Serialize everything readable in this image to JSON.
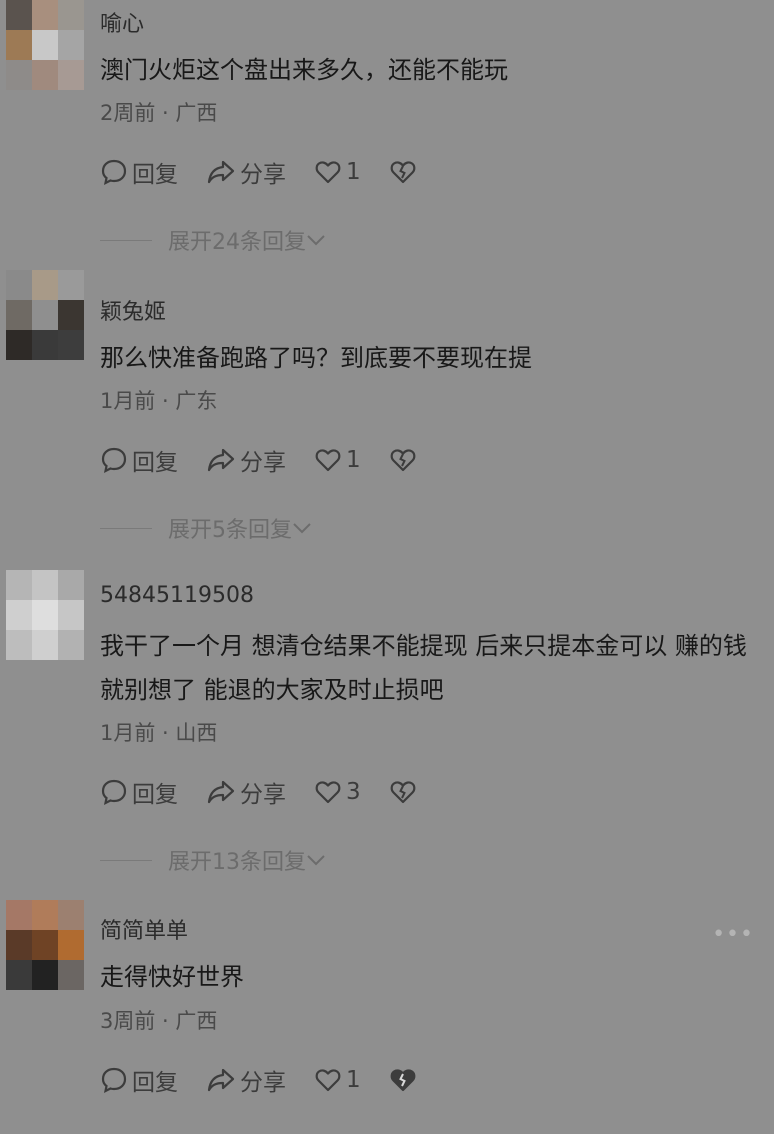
{
  "comments": [
    {
      "username": "喻心",
      "text": "澳门火炬这个盘出来多久，还能不能玩",
      "meta": "2周前 · 广西",
      "reply_label": "回复",
      "share_label": "分享",
      "likes": "1",
      "expand_label": "展开24条回复",
      "avatar_colors": [
        "#5a534e",
        "#a88f7e",
        "#9a9690",
        "#9d7a55",
        "#c8c8c8",
        "#a5a5a5",
        "#8e8b89",
        "#a08a7e",
        "#a79a94"
      ]
    },
    {
      "username": "颖兔姬",
      "text": "那么快准备跑路了吗？到底要不要现在提",
      "meta": "1月前 · 广东",
      "reply_label": "回复",
      "share_label": "分享",
      "likes": "1",
      "expand_label": "展开5条回复",
      "avatar_colors": [
        "#8a8a8a",
        "#a89a88",
        "#9a9a9a",
        "#6f6a64",
        "#8f8f8f",
        "#3b3631",
        "#2e2a27",
        "#3a3a3a",
        "#3d3d3d"
      ]
    },
    {
      "username": "54845119508",
      "text": "我干了一个月 想清仓结果不能提现 后来只提本金可以 赚的钱 就别想了 能退的大家及时止损吧",
      "meta": "1月前 · 山西",
      "reply_label": "回复",
      "share_label": "分享",
      "likes": "3",
      "expand_label": "展开13条回复",
      "avatar_colors": [
        "#b5b5b5",
        "#c4c4c4",
        "#a9a9a9",
        "#cfcfcf",
        "#dedede",
        "#c6c6c6",
        "#bdbdbd",
        "#cfcfcf",
        "#b2b2b2"
      ]
    },
    {
      "username": "简简单单",
      "text": "走得快好世界",
      "meta": "3周前 · 广西",
      "reply_label": "回复",
      "share_label": "分享",
      "likes": "1",
      "avatar_colors": [
        "#a57866",
        "#b07c5a",
        "#9c8070",
        "#5a3a28",
        "#6f4325",
        "#b06b30",
        "#3a3a3a",
        "#222222",
        "#6b6663"
      ]
    }
  ],
  "more_label": "•••"
}
